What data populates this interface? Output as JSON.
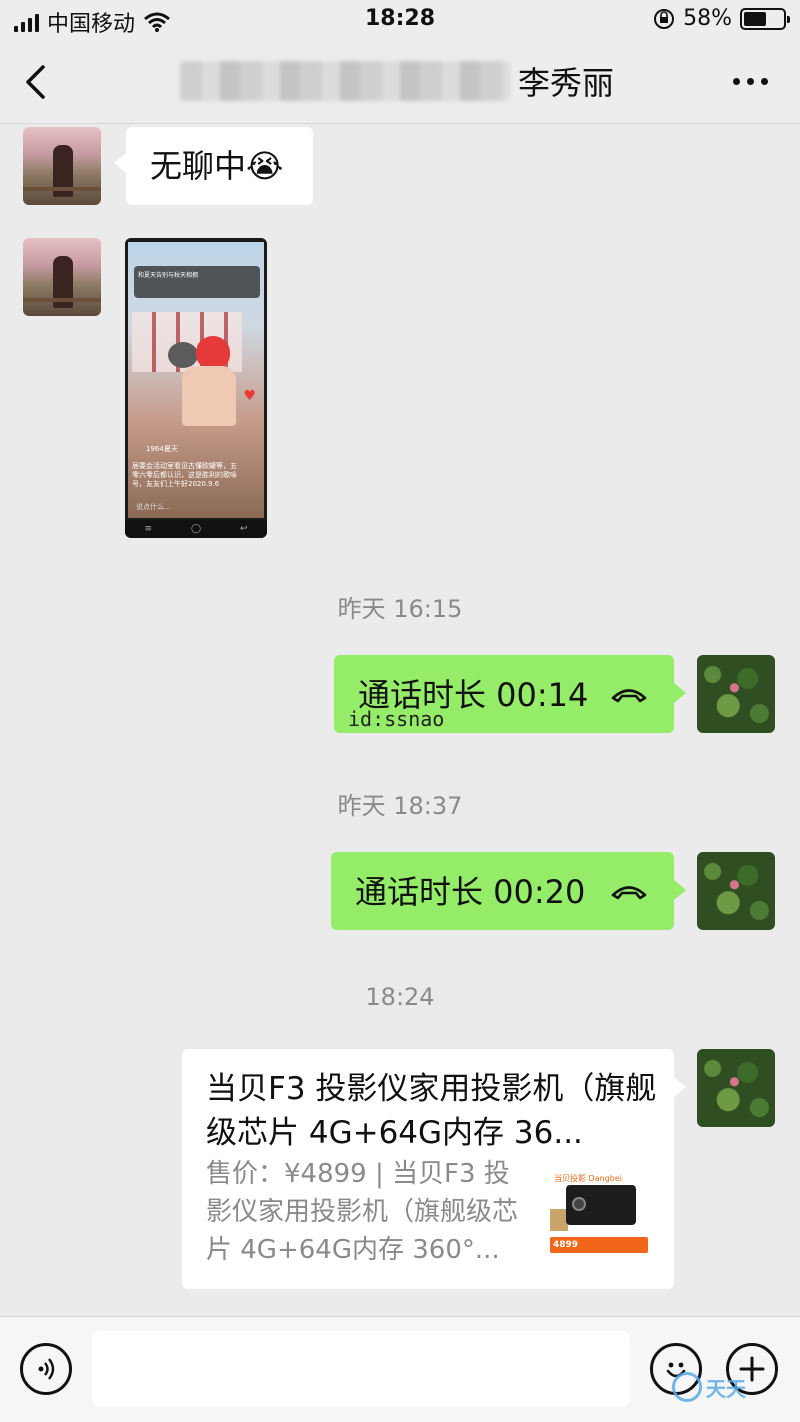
{
  "status_bar": {
    "carrier": "中国移动",
    "time": "18:28",
    "battery_percent": "58%",
    "battery_level": 0.58
  },
  "nav": {
    "title_visible": "李秀丽",
    "title_redacted": true
  },
  "messages": {
    "m1_text": "无聊中😭",
    "m2_type": "image-screenshot",
    "m2_thumb": {
      "header": "和夏天告别与秋天相拥",
      "caption": "居委会活动室看见古懂欧罐等，五零六零后都认识，这是胜利的歌咏号，友友们上午好2020.9.6",
      "user": "1964夏天",
      "comment_hint": "说点什么..."
    },
    "ts1": "昨天 16:15",
    "m3_text": "通话时长 00:14",
    "m3_watermark": "id:ssnao",
    "ts2": "昨天 18:37",
    "m4_text": "通话时长 00:20",
    "ts3": "18:24",
    "m5_card": {
      "title": "当贝F3 投影仪家用投影机（旗舰级芯片 4G+64G内存 36...",
      "desc": "售价：¥4899 | 当贝F3 投影仪家用投影机（旗舰级芯片 4G+64G内存 360°...",
      "img_brand": "当贝投影 Dangbei",
      "img_price": "4899"
    }
  },
  "input_bar": {
    "placeholder": ""
  },
  "corner_logo_text": "天天"
}
